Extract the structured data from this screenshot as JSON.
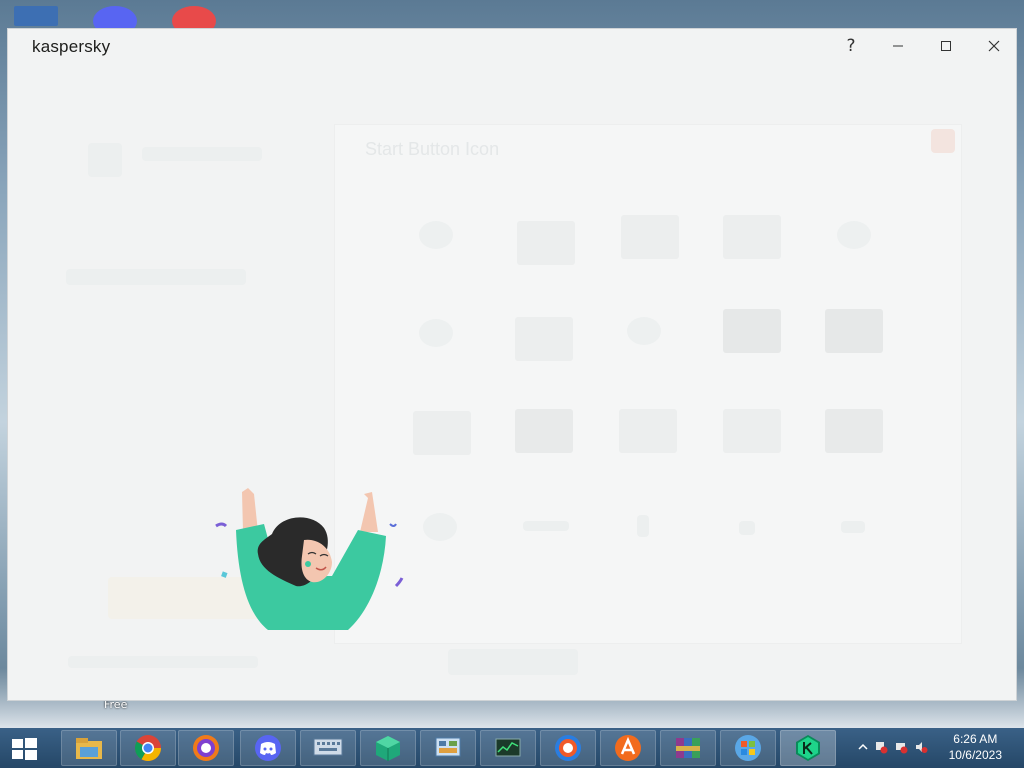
{
  "desktop": {
    "icon_label": "Free"
  },
  "window": {
    "logo_text": "kaspersky",
    "help_label": "?",
    "dialog_title": "Start Button Icon"
  },
  "taskbar": {
    "items": [
      {
        "icon": "file-explorer-icon"
      },
      {
        "icon": "chrome-icon"
      },
      {
        "icon": "avast-secure-browser-icon"
      },
      {
        "icon": "discord-icon"
      },
      {
        "icon": "on-screen-keyboard-icon"
      },
      {
        "icon": "green-cube-app-icon"
      },
      {
        "icon": "control-panel-icon"
      },
      {
        "icon": "performance-monitor-icon"
      },
      {
        "icon": "ccleaner-browser-icon"
      },
      {
        "icon": "avast-icon"
      },
      {
        "icon": "winrar-icon"
      },
      {
        "icon": "windows-7-start-icon"
      },
      {
        "icon": "kaspersky-icon"
      }
    ],
    "clock": {
      "time": "6:26 AM",
      "date": "10/6/2023"
    }
  },
  "colors": {
    "window_bg": "#f2f3f3",
    "taskbar": "#2e5277",
    "illustration_shirt": "#3cc9a0",
    "illustration_hair": "#2a2a2a"
  }
}
